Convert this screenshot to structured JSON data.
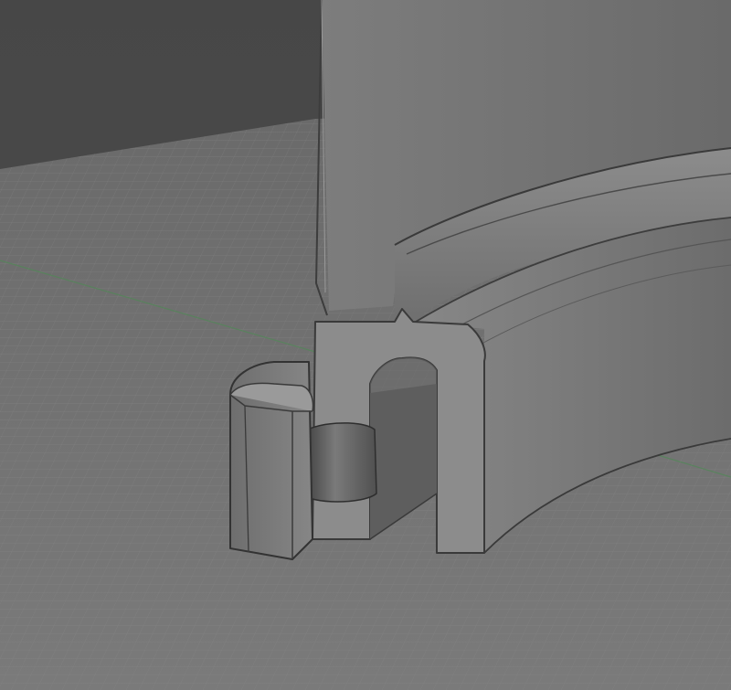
{
  "viewport": {
    "background_color": "#4b4b4b",
    "grid_color": "#8a8a8a",
    "grid_axis_color": "#5a8a5a",
    "model_color": "#7b7b7b"
  }
}
